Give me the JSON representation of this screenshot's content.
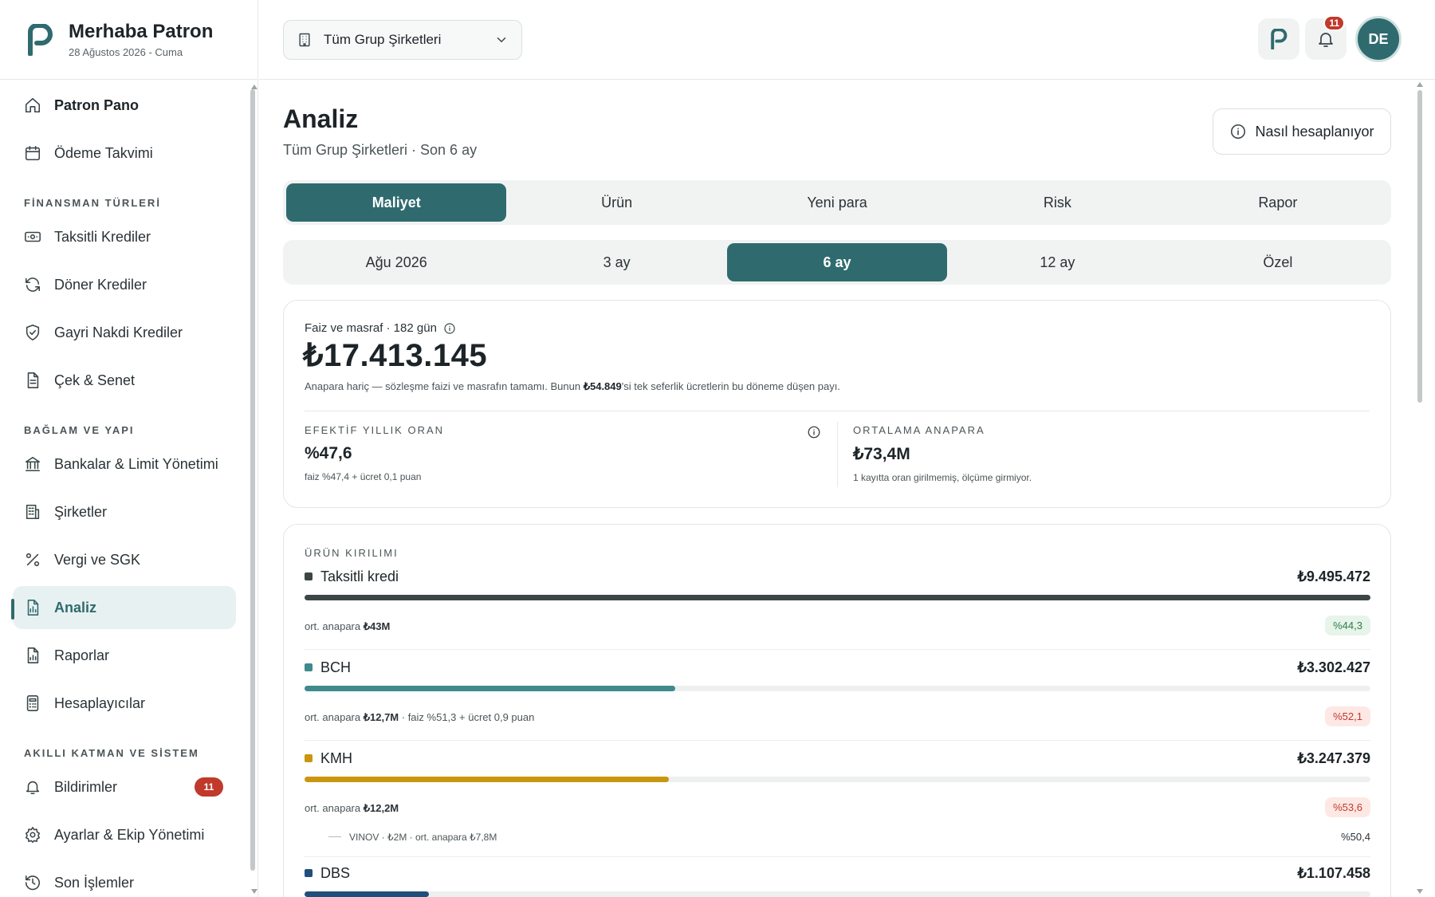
{
  "brand": {
    "title": "Merhaba Patron",
    "date": "28 Ağustos 2026 - Cuma",
    "logo_icon": "p-logo-icon"
  },
  "sidebar": {
    "top_items": [
      {
        "label": "Patron Pano",
        "icon": "home-icon"
      },
      {
        "label": "Ödeme Takvimi",
        "icon": "calendar-icon"
      }
    ],
    "sections": [
      {
        "title": "FİNANSMAN TÜRLERİ",
        "items": [
          {
            "label": "Taksitli Krediler",
            "icon": "banknote-icon"
          },
          {
            "label": "Döner Krediler",
            "icon": "refresh-icon"
          },
          {
            "label": "Gayri Nakdi Krediler",
            "icon": "shield-icon"
          },
          {
            "label": "Çek & Senet",
            "icon": "document-icon"
          }
        ]
      },
      {
        "title": "BAĞLAM VE YAPI",
        "items": [
          {
            "label": "Bankalar & Limit Yönetimi",
            "icon": "bank-icon"
          },
          {
            "label": "Şirketler",
            "icon": "building-icon"
          },
          {
            "label": "Vergi ve SGK",
            "icon": "percent-icon"
          },
          {
            "label": "Analiz",
            "icon": "chart-file-icon",
            "active": true
          },
          {
            "label": "Raporlar",
            "icon": "report-icon"
          },
          {
            "label": "Hesaplayıcılar",
            "icon": "calculator-icon"
          }
        ]
      },
      {
        "title": "AKILLI KATMAN VE SİSTEM",
        "items": [
          {
            "label": "Bildirimler",
            "icon": "bell-icon",
            "badge": "11"
          },
          {
            "label": "Ayarlar & Ekip Yönetimi",
            "icon": "gear-icon"
          },
          {
            "label": "Son İşlemler",
            "icon": "history-icon"
          }
        ]
      }
    ]
  },
  "header": {
    "company_select": "Tüm Grup Şirketleri",
    "notification_count": "11",
    "avatar_initials": "DE"
  },
  "page": {
    "title": "Analiz",
    "subtitle": "Tüm Grup Şirketleri · Son 6 ay",
    "how_button": "Nasıl hesaplanıyor",
    "tabs": [
      "Maliyet",
      "Ürün",
      "Yeni para",
      "Risk",
      "Rapor"
    ],
    "active_tab": 0,
    "periods": [
      "Ağu 2026",
      "3 ay",
      "6 ay",
      "12 ay",
      "Özel"
    ],
    "active_period": 2
  },
  "kpi": {
    "head": "Faiz ve masraf · 182 gün",
    "value": "₺17.413.145",
    "note_pre": "Anapara hariç — sözleşme faizi ve masrafın tamamı. Bunun ",
    "note_amount": "₺54.849",
    "note_post": "'si tek seferlik ücretlerin bu döneme düşen payı.",
    "effective_label": "EFEKTİF YILLIK ORAN",
    "effective_value": "%47,6",
    "effective_note": "faiz %47,4 + ücret 0,1 puan",
    "avg_label": "ORTALAMA ANAPARA",
    "avg_value": "₺73,4M",
    "avg_note": "1 kayıtta oran girilmemiş, ölçüme girmiyor."
  },
  "breakdown": {
    "title": "ÜRÜN KIRILIMI",
    "meta_prefix": "ort. anapara",
    "products": [
      {
        "name": "Taksitli kredi",
        "amount": "₺9.495.472",
        "share": 1.0,
        "color": "#3d4547",
        "avg": "₺43M",
        "extra": "",
        "pct": "%44,3",
        "pct_tone": "green"
      },
      {
        "name": "BCH",
        "amount": "₺3.302.427",
        "share": 0.348,
        "color": "#3f8a8c",
        "avg": "₺12,7M",
        "extra": " · faiz %51,3 + ücret 0,9 puan",
        "pct": "%52,1",
        "pct_tone": "red"
      },
      {
        "name": "KMH",
        "amount": "₺3.247.379",
        "share": 0.342,
        "color": "#c9960f",
        "avg": "₺12,2M",
        "extra": "",
        "pct": "%53,6",
        "pct_tone": "red",
        "sub": {
          "label": "VINOV · ₺2M · ort. anapara ₺7,8M",
          "pct": "%50,4"
        }
      },
      {
        "name": "DBS",
        "amount": "₺1.107.458",
        "share": 0.117,
        "color": "#1f4f7a"
      }
    ]
  }
}
